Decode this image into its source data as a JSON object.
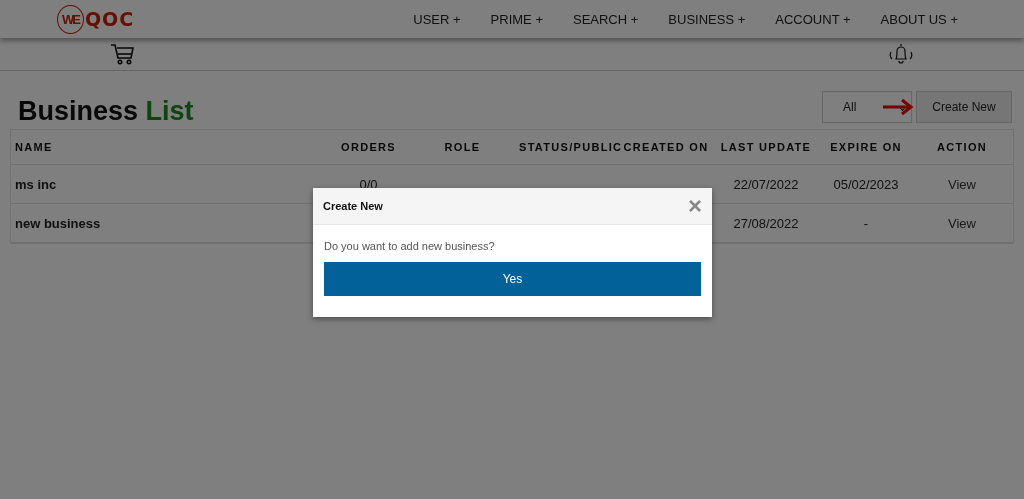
{
  "logo": {
    "mark": "WE",
    "name": "QOC"
  },
  "nav": [
    "USER +",
    "PRIME +",
    "SEARCH +",
    "BUSINESS +",
    "ACCOUNT +",
    "ABOUT US +"
  ],
  "title": {
    "main": "Business",
    "accent": "List"
  },
  "filter": {
    "value": "All"
  },
  "create_button": "Create New",
  "table": {
    "columns": [
      "NAME",
      "ORDERS",
      "ROLE",
      "STATUS/PUBLIC",
      "CREATED ON",
      "LAST UPDATE",
      "EXPIRE ON",
      "ACTION"
    ],
    "rows": [
      {
        "name": "ms inc",
        "orders": "0/0",
        "last_update": "22/07/2022",
        "expire_on": "05/02/2023",
        "action": "View"
      },
      {
        "name": "new business",
        "last_update": "27/08/2022",
        "expire_on": "-",
        "action": "View"
      }
    ]
  },
  "dialog": {
    "title": "Create New",
    "close": "×",
    "message": "Do you want to add new business?",
    "confirm": "Yes"
  }
}
